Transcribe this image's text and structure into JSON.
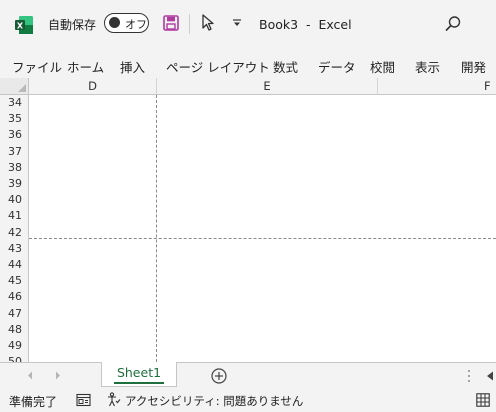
{
  "title_bar": {
    "autosave_label": "自動保存",
    "autosave_state": "オフ",
    "document_title": "Book3  -  Excel"
  },
  "ribbon": {
    "tabs": [
      "ファイル",
      "ホーム",
      "挿入",
      "ページ レイアウト",
      "数式",
      "データ",
      "校閲",
      "表示",
      "開発"
    ]
  },
  "sheet": {
    "columns": [
      "D",
      "E",
      "F"
    ],
    "rows": [
      "34",
      "35",
      "36",
      "37",
      "38",
      "39",
      "40",
      "41",
      "42",
      "43",
      "44",
      "45",
      "46",
      "47",
      "48",
      "49",
      "50"
    ]
  },
  "sheet_tabs": {
    "active": "Sheet1"
  },
  "status_bar": {
    "ready": "準備完了",
    "accessibility": "アクセシビリティ: 問題ありません"
  },
  "colors": {
    "excel_green": "#1e6e3e",
    "save_icon": "#b03aa0"
  }
}
